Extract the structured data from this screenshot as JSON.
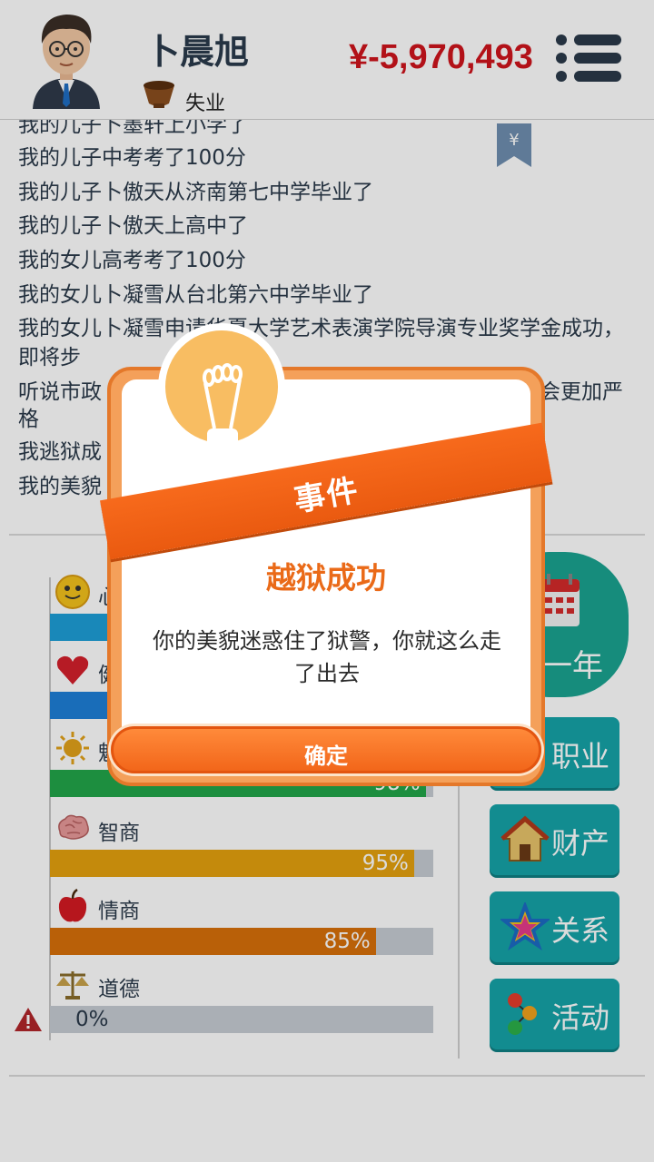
{
  "header": {
    "player_name": "卜晨旭",
    "job": "失业",
    "money": "¥-5,970,493"
  },
  "log": {
    "lines": [
      "我的儿子卜墨轩上小学了",
      "我的儿子中考考了100分",
      "我的儿子卜傲天从济南第七中学毕业了",
      "我的儿子卜傲天上高中了",
      "我的女儿高考考了100分",
      "我的女儿卜凝雪从台北第六中学毕业了",
      "我的女儿卜凝雪申请华夏大学艺术表演学院导演专业奖学金成功，即将步",
      "听说市政",
      "会更加严",
      "格",
      "我逃狱成",
      "我的美貌"
    ]
  },
  "stats": [
    {
      "label": "心",
      "percent": null,
      "color": "#1e9fd8"
    },
    {
      "label": "健",
      "percent": null,
      "color": "#1e7fd8"
    },
    {
      "label": "魅",
      "percent": "98%",
      "color": "#22a64a",
      "value": 98
    },
    {
      "label": "智商",
      "percent": "95%",
      "color": "#e5a10f",
      "value": 95
    },
    {
      "label": "情商",
      "percent": "85%",
      "color": "#d8700a",
      "value": 85
    },
    {
      "label": "道德",
      "percent": "0%",
      "color": "#c6ccd3",
      "value": 0
    }
  ],
  "side_buttons": {
    "year": "一年",
    "career": "职业",
    "property": "财产",
    "relations": "关系",
    "activity": "活动"
  },
  "dialog": {
    "ribbon": "事件",
    "title": "越狱成功",
    "description": "你的美貌迷惑住了狱警，你就这么走了出去",
    "ok": "确定"
  },
  "colors": {
    "money": "#d0141c",
    "accent_orange": "#f2661a",
    "teal": "#15a3a8"
  }
}
